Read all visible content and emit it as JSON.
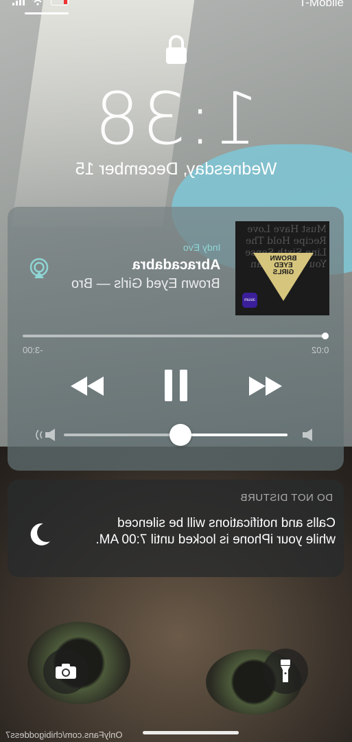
{
  "status": {
    "carrier": "T-Mobile"
  },
  "lock_screen": {
    "time": "1:38",
    "date": "Wednesday, December 15"
  },
  "now_playing": {
    "source": "Indy Evo",
    "song": "Abracadabra",
    "artist_line": "Brown Eyed Girls — Bro",
    "album_art_text": "Must Have Love Recipe Hold The Line Sixth Sense You Candy Man",
    "album_art_label": "BROWN EYED GIRLS",
    "album_art_badge": "music",
    "elapsed": "0:02",
    "remaining": "-3:00",
    "progress": 0.01,
    "volume": 0.45
  },
  "dnd": {
    "title": "DO NOT DISTURB",
    "message": "Calls and notifications will be silenced while your iPhone is locked until 7:00 AM."
  },
  "watermark": "OnlyFans.com/chibigoddess7",
  "icons": {
    "lock": "lock-icon",
    "airplay": "airplay-icon",
    "rewind": "rewind-icon",
    "pause": "pause-icon",
    "forward": "fast-forward-icon",
    "moon": "moon-icon",
    "camera": "camera-icon",
    "flashlight": "flashlight-icon"
  }
}
